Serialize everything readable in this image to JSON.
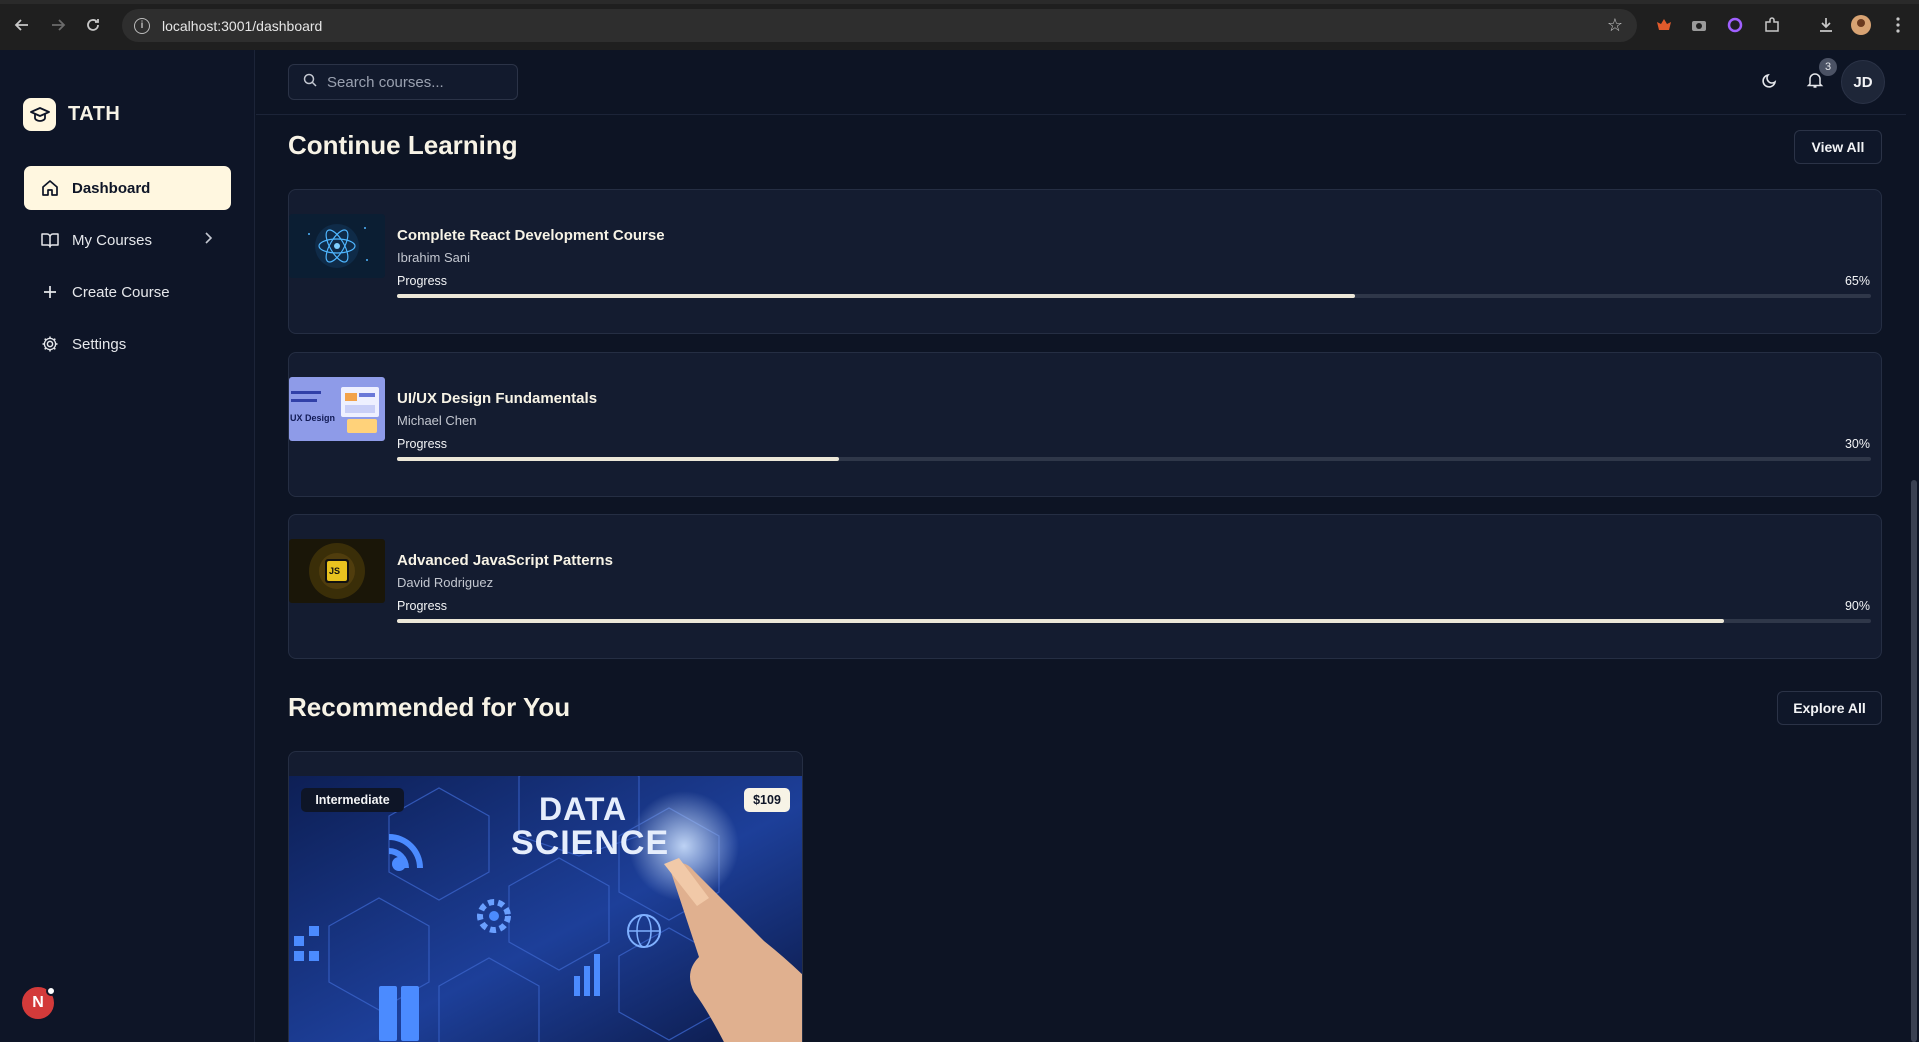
{
  "browser": {
    "url": "localhost:3001/dashboard"
  },
  "sidebar": {
    "logo_text": "TATH",
    "items": [
      {
        "label": "Dashboard"
      },
      {
        "label": "My Courses"
      },
      {
        "label": "Create Course"
      },
      {
        "label": "Settings"
      }
    ],
    "user_initial": "N"
  },
  "header": {
    "search_placeholder": "Search courses...",
    "notification_count": "3",
    "user_initials": "JD"
  },
  "continue_learning": {
    "title": "Continue Learning",
    "view_all_label": "View All",
    "courses": [
      {
        "title": "Complete React Development Course",
        "instructor": "Ibrahim Sani",
        "progress_label": "Progress",
        "progress": 65,
        "progress_text": "65%"
      },
      {
        "title": "UI/UX Design Fundamentals",
        "instructor": "Michael Chen",
        "progress_label": "Progress",
        "progress": 30,
        "progress_text": "30%"
      },
      {
        "title": "Advanced JavaScript Patterns",
        "instructor": "David Rodriguez",
        "progress_label": "Progress",
        "progress": 90,
        "progress_text": "90%"
      }
    ]
  },
  "recommended": {
    "title": "Recommended for You",
    "explore_all_label": "Explore All",
    "cards": [
      {
        "level": "Intermediate",
        "price": "$109",
        "image_text_1": "DATA",
        "image_text_2": "SCIENCE"
      }
    ]
  },
  "thumb_texts": {
    "uiux_line": "UX Design"
  },
  "js_badge": "JS",
  "colors": {
    "background": "#0d1424",
    "card": "#141c30",
    "accent_cream": "#fff7e0",
    "progress_fill": "#ece7d8"
  }
}
